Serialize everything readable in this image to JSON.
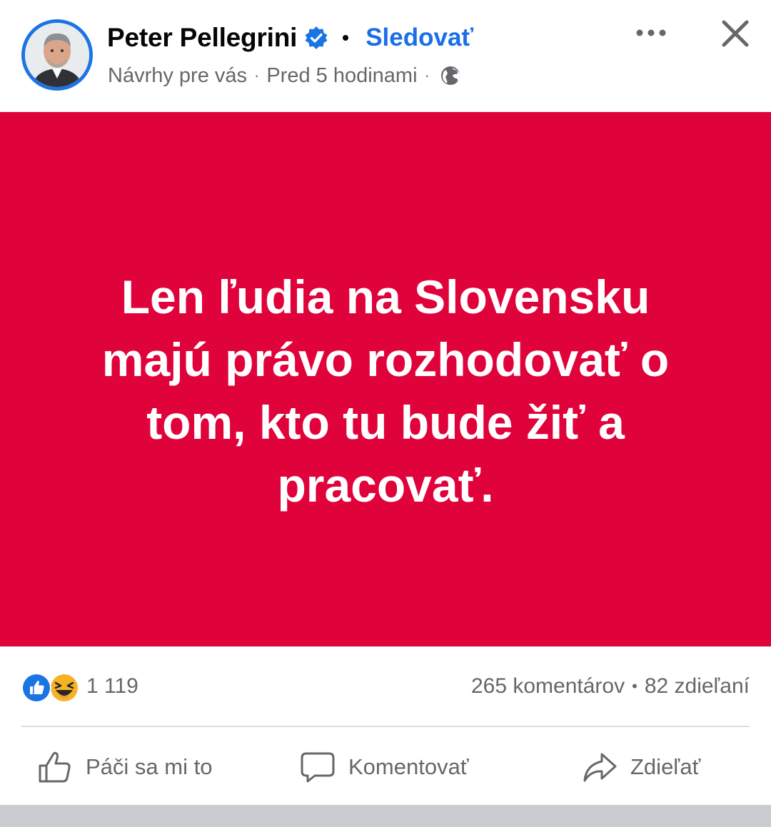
{
  "header": {
    "author_name": "Peter Pellegrini",
    "follow_label": "Sledovať",
    "suggestion_label": "Návrhy pre vás",
    "time_label": "Pred 5 hodinami",
    "avatar_icon": "profile-photo",
    "verified_icon": "verified-badge-icon",
    "privacy_icon": "globe-icon",
    "more_icon": "more-dots-icon",
    "close_icon": "close-icon"
  },
  "post": {
    "background_color": "#e0023b",
    "lines": [
      "Len ľudia na Slovensku",
      "majú právo rozhodovať o",
      "tom, kto tu bude žiť a",
      "pracovať."
    ]
  },
  "stats": {
    "reaction_icons": [
      "like-reaction-icon",
      "haha-reaction-icon"
    ],
    "reaction_count": "1 119",
    "comments_label": "265 komentárov",
    "shares_label": "82 zdieľaní"
  },
  "actions": {
    "like_label": "Páči sa mi to",
    "comment_label": "Komentovať",
    "share_label": "Zdieľať"
  },
  "colors": {
    "accent": "#1b6ee6",
    "muted_text": "#65676b"
  }
}
